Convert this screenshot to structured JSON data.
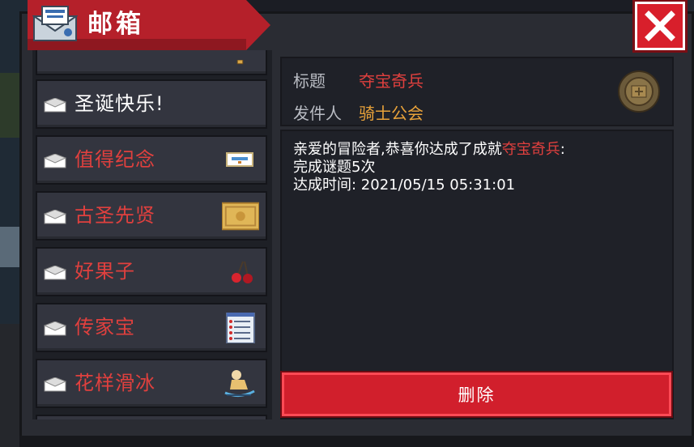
{
  "window": {
    "title": "邮箱",
    "close_label": "×"
  },
  "mail_list": {
    "items": [
      {
        "label": "",
        "color": "orange",
        "thumb": "chest-icon"
      },
      {
        "label": "圣诞快乐!",
        "color": "white",
        "thumb": ""
      },
      {
        "label": "值得纪念",
        "color": "red",
        "thumb": "card-icon"
      },
      {
        "label": "古圣先贤",
        "color": "red",
        "thumb": "gold-plaque-icon"
      },
      {
        "label": "好果子",
        "color": "red",
        "thumb": "cherry-icon"
      },
      {
        "label": "传家宝",
        "color": "red",
        "thumb": "scroll-list-icon"
      },
      {
        "label": "花样滑冰",
        "color": "red",
        "thumb": "skater-icon"
      }
    ]
  },
  "detail": {
    "title_label": "标题",
    "title_value": "夺宝奇兵",
    "sender_label": "发件人",
    "sender_value": "骑士公会",
    "body_prefix": "亲爱的冒险者,恭喜你达成了成就",
    "body_achievement": "夺宝奇兵",
    "body_suffix": ":",
    "body_line2": "完成谜题5次",
    "body_line3": "达成时间: 2021/05/15 05:31:01",
    "delete_label": "删除"
  },
  "colors": {
    "accent_red": "#d11f2c",
    "highlight_red": "#e0403e",
    "sender_orange": "#e8a23a"
  }
}
